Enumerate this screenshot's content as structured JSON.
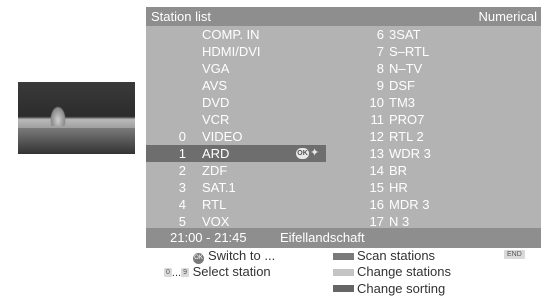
{
  "header": {
    "title": "Station list",
    "sort_mode": "Numerical"
  },
  "left_stations": [
    {
      "num": "",
      "name": "COMP. IN"
    },
    {
      "num": "",
      "name": "HDMI/DVI"
    },
    {
      "num": "",
      "name": "VGA"
    },
    {
      "num": "",
      "name": "AVS"
    },
    {
      "num": "",
      "name": "DVD"
    },
    {
      "num": "",
      "name": "VCR"
    },
    {
      "num": "0",
      "name": "VIDEO"
    },
    {
      "num": "1",
      "name": "ARD"
    },
    {
      "num": "2",
      "name": "ZDF"
    },
    {
      "num": "3",
      "name": "SAT.1"
    },
    {
      "num": "4",
      "name": "RTL"
    },
    {
      "num": "5",
      "name": "VOX"
    }
  ],
  "right_stations": [
    {
      "num": "6",
      "name": "3SAT"
    },
    {
      "num": "7",
      "name": "S–RTL"
    },
    {
      "num": "8",
      "name": "N–TV"
    },
    {
      "num": "9",
      "name": "DSF"
    },
    {
      "num": "10",
      "name": "TM3"
    },
    {
      "num": "11",
      "name": "PRO7"
    },
    {
      "num": "12",
      "name": "RTL 2"
    },
    {
      "num": "13",
      "name": "WDR 3"
    },
    {
      "num": "14",
      "name": "BR"
    },
    {
      "num": "15",
      "name": "HR"
    },
    {
      "num": "16",
      "name": "MDR 3"
    },
    {
      "num": "17",
      "name": "N 3"
    }
  ],
  "selected": {
    "ok_badge": "OK",
    "nav_icon": "four-way-arrows-icon"
  },
  "info": {
    "time": "21:00 - 21:45",
    "programme": "Eifellandschaft"
  },
  "legend": {
    "ok_key": "OK",
    "switch_label": "Switch to ...",
    "key_0": "0",
    "range_sep": "...",
    "key_9": "9",
    "select_label": "Select station",
    "scan_label": "Scan stations",
    "change_stations_label": "Change stations",
    "change_sorting_label": "Change sorting",
    "end_key": "END"
  },
  "colors": {
    "red_key": "#7a7a7a",
    "green_key": "#c4c4c4",
    "blue_key": "#666666"
  }
}
